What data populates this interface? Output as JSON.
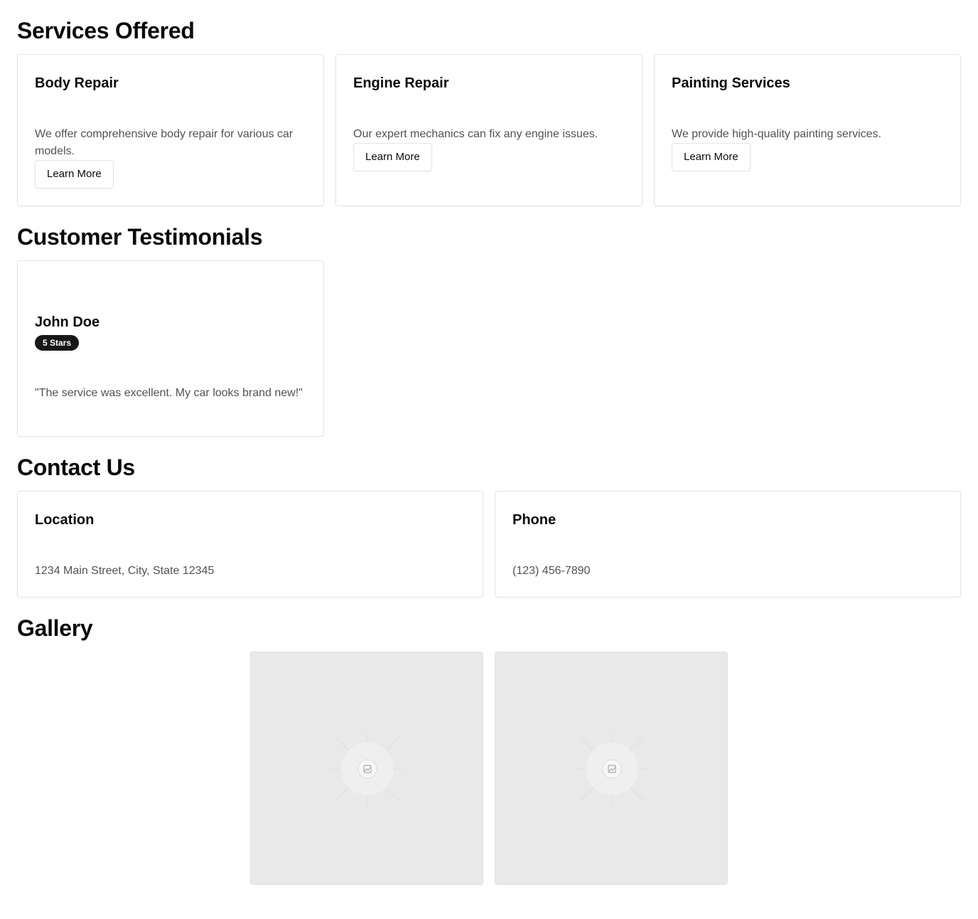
{
  "services": {
    "title": "Services Offered",
    "items": [
      {
        "title": "Body Repair",
        "description": "We offer comprehensive body repair for various car models.",
        "button": "Learn More"
      },
      {
        "title": "Engine Repair",
        "description": "Our expert mechanics can fix any engine issues.",
        "button": "Learn More"
      },
      {
        "title": "Painting Services",
        "description": "We provide high-quality painting services.",
        "button": "Learn More"
      }
    ]
  },
  "testimonials": {
    "title": "Customer Testimonials",
    "items": [
      {
        "name": "John Doe",
        "rating": "5 Stars",
        "quote": "\"The service was excellent. My car looks brand new!\""
      }
    ]
  },
  "contact": {
    "title": "Contact Us",
    "location": {
      "title": "Location",
      "value": "1234 Main Street, City, State 12345"
    },
    "phone": {
      "title": "Phone",
      "value": "(123) 456-7890"
    }
  },
  "gallery": {
    "title": "Gallery",
    "images": [
      {
        "icon": "image-placeholder-icon"
      },
      {
        "icon": "image-placeholder-icon"
      }
    ]
  }
}
